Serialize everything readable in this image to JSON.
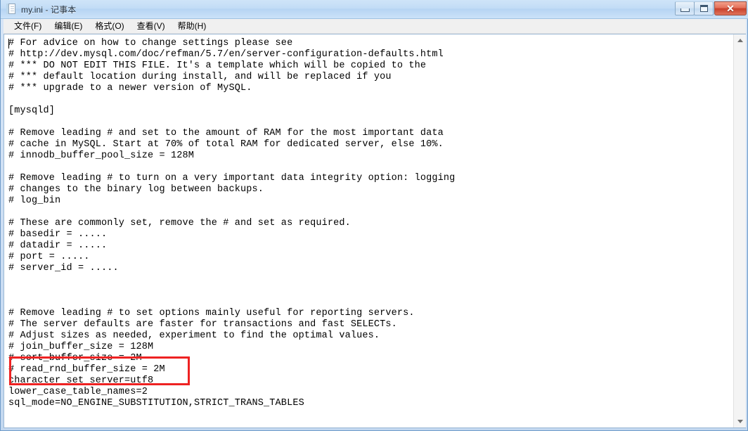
{
  "window": {
    "title": "my.ini - 记事本",
    "icon": "notepad-document-icon",
    "controls": {
      "minimize_label": "最小化",
      "maximize_label": "最大化",
      "close_label": "✕"
    }
  },
  "menubar": {
    "items": [
      {
        "label": "文件(F)"
      },
      {
        "label": "编辑(E)"
      },
      {
        "label": "格式(O)"
      },
      {
        "label": "查看(V)"
      },
      {
        "label": "帮助(H)"
      }
    ]
  },
  "editor": {
    "filename": "my.ini",
    "lines": [
      "# For advice on how to change settings please see",
      "# http://dev.mysql.com/doc/refman/5.7/en/server-configuration-defaults.html",
      "# *** DO NOT EDIT THIS FILE. It's a template which will be copied to the",
      "# *** default location during install, and will be replaced if you",
      "# *** upgrade to a newer version of MySQL.",
      "",
      "[mysqld]",
      "",
      "# Remove leading # and set to the amount of RAM for the most important data",
      "# cache in MySQL. Start at 70% of total RAM for dedicated server, else 10%.",
      "# innodb_buffer_pool_size = 128M",
      "",
      "# Remove leading # to turn on a very important data integrity option: logging",
      "# changes to the binary log between backups.",
      "# log_bin",
      "",
      "# These are commonly set, remove the # and set as required.",
      "# basedir = .....",
      "# datadir = .....",
      "# port = .....",
      "# server_id = .....",
      "",
      "",
      "",
      "# Remove leading # to set options mainly useful for reporting servers.",
      "# The server defaults are faster for transactions and fast SELECTs.",
      "# Adjust sizes as needed, experiment to find the optimal values.",
      "# join_buffer_size = 128M",
      "# sort_buffer_size = 2M",
      "# read_rnd_buffer_size = 2M",
      "character_set_server=utf8",
      "lower_case_table_names=2",
      "sql_mode=NO_ENGINE_SUBSTITUTION,STRICT_TRANS_TABLES"
    ]
  },
  "annotation": {
    "type": "red-rectangle-highlight",
    "color": "#ee2222",
    "highlighted_lines": [
      "character_set_server=utf8",
      "lower_case_table_names=2"
    ]
  },
  "scrollbar": {
    "up_arrow": "scroll-up-arrow-icon",
    "down_arrow": "scroll-down-arrow-icon"
  }
}
